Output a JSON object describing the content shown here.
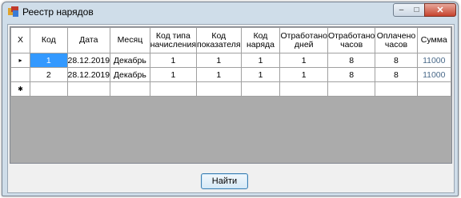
{
  "window": {
    "title": "Реестр нарядов"
  },
  "caption": {
    "minimize": "–",
    "maximize": "□",
    "close": "✕"
  },
  "table": {
    "columns": [
      "Х",
      "Код",
      "Дата",
      "Месяц",
      "Код типа начисления",
      "Код показателя",
      "Код наряда",
      "Отработано дней",
      "Отработано часов",
      "Оплачено часов",
      "Сумма"
    ],
    "rows": [
      {
        "marker": "▸",
        "cells": [
          "1",
          "28.12.2019",
          "Декабрь",
          "1",
          "1",
          "1",
          "1",
          "8",
          "8",
          "11000"
        ]
      },
      {
        "marker": "",
        "cells": [
          "2",
          "28.12.2019",
          "Декабрь",
          "1",
          "1",
          "1",
          "1",
          "8",
          "8",
          "11000"
        ]
      },
      {
        "marker": "✱",
        "cells": [
          "",
          "",
          "",
          "",
          "",
          "",
          "",
          "",
          "",
          ""
        ]
      }
    ]
  },
  "buttons": {
    "find": "Найти"
  },
  "colors": {
    "selection": "#3399ff",
    "empty_area": "#ababab",
    "window_frame": "#cfdde9"
  }
}
